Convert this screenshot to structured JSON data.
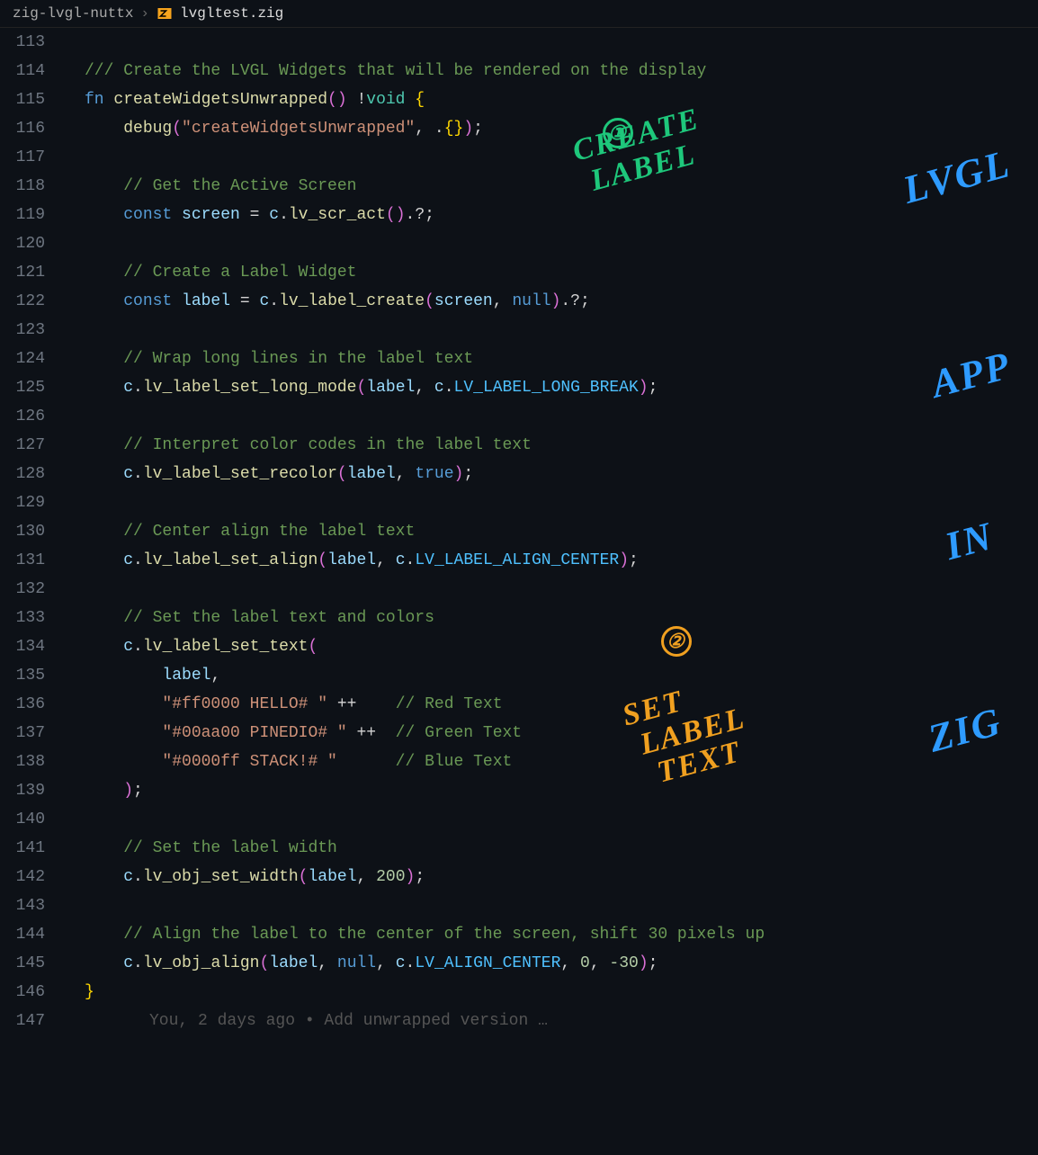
{
  "breadcrumb": {
    "folder": "zig-lvgl-nuttx",
    "file": "lvgltest.zig"
  },
  "annotations": {
    "circle1": "①",
    "create_label": "CREATE LABEL",
    "lvgl": "LVGL",
    "app": "APP",
    "in": "IN",
    "zig": "ZIG",
    "circle2": "②",
    "set_label_text": "SET LABEL TEXT"
  },
  "blame": "You, 2 days ago • Add unwrapped version …",
  "lines": [
    {
      "num": "113",
      "bar": "hash",
      "tokens": []
    },
    {
      "num": "114",
      "bar": "hash",
      "tokens": [
        [
          "comment",
          "/// Create the LVGL Widgets that will be rendered on the display"
        ]
      ]
    },
    {
      "num": "115",
      "tokens": [
        [
          "keyword",
          "fn "
        ],
        [
          "fn",
          "createWidgetsUnwrapped"
        ],
        [
          "paren",
          "()"
        ],
        [
          "punc",
          " !"
        ],
        [
          "type",
          "void"
        ],
        [
          "punc",
          " "
        ],
        [
          "brace",
          "{"
        ]
      ]
    },
    {
      "num": "116",
      "tokens": [
        [
          "punc",
          "    "
        ],
        [
          "fn",
          "debug"
        ],
        [
          "paren",
          "("
        ],
        [
          "string",
          "\"createWidgetsUnwrapped\""
        ],
        [
          "punc",
          ", ."
        ],
        [
          "brace",
          "{}"
        ],
        [
          "paren",
          ")"
        ],
        [
          "punc",
          ";"
        ]
      ]
    },
    {
      "num": "117",
      "tokens": []
    },
    {
      "num": "118",
      "tokens": [
        [
          "punc",
          "    "
        ],
        [
          "comment",
          "// Get the Active Screen"
        ]
      ]
    },
    {
      "num": "119",
      "tokens": [
        [
          "punc",
          "    "
        ],
        [
          "keyword",
          "const "
        ],
        [
          "var",
          "screen"
        ],
        [
          "punc",
          " = "
        ],
        [
          "var",
          "c"
        ],
        [
          "punc",
          "."
        ],
        [
          "fn",
          "lv_scr_act"
        ],
        [
          "paren",
          "()"
        ],
        [
          "punc",
          ".?;"
        ]
      ]
    },
    {
      "num": "120",
      "tokens": []
    },
    {
      "num": "121",
      "tokens": [
        [
          "punc",
          "    "
        ],
        [
          "comment",
          "// Create a Label Widget"
        ]
      ]
    },
    {
      "num": "122",
      "tokens": [
        [
          "punc",
          "    "
        ],
        [
          "keyword",
          "const "
        ],
        [
          "var",
          "label"
        ],
        [
          "punc",
          " = "
        ],
        [
          "var",
          "c"
        ],
        [
          "punc",
          "."
        ],
        [
          "fn",
          "lv_label_create"
        ],
        [
          "paren",
          "("
        ],
        [
          "var",
          "screen"
        ],
        [
          "punc",
          ", "
        ],
        [
          "null",
          "null"
        ],
        [
          "paren",
          ")"
        ],
        [
          "punc",
          ".?;"
        ]
      ]
    },
    {
      "num": "123",
      "tokens": []
    },
    {
      "num": "124",
      "tokens": [
        [
          "punc",
          "    "
        ],
        [
          "comment",
          "// Wrap long lines in the label text"
        ]
      ]
    },
    {
      "num": "125",
      "tokens": [
        [
          "punc",
          "    "
        ],
        [
          "var",
          "c"
        ],
        [
          "punc",
          "."
        ],
        [
          "fn",
          "lv_label_set_long_mode"
        ],
        [
          "paren",
          "("
        ],
        [
          "var",
          "label"
        ],
        [
          "punc",
          ", "
        ],
        [
          "var",
          "c"
        ],
        [
          "punc",
          "."
        ],
        [
          "const",
          "LV_LABEL_LONG_BREAK"
        ],
        [
          "paren",
          ")"
        ],
        [
          "punc",
          ";"
        ]
      ]
    },
    {
      "num": "126",
      "tokens": []
    },
    {
      "num": "127",
      "tokens": [
        [
          "punc",
          "    "
        ],
        [
          "comment",
          "// Interpret color codes in the label text"
        ]
      ]
    },
    {
      "num": "128",
      "tokens": [
        [
          "punc",
          "    "
        ],
        [
          "var",
          "c"
        ],
        [
          "punc",
          "."
        ],
        [
          "fn",
          "lv_label_set_recolor"
        ],
        [
          "paren",
          "("
        ],
        [
          "var",
          "label"
        ],
        [
          "punc",
          ", "
        ],
        [
          "null",
          "true"
        ],
        [
          "paren",
          ")"
        ],
        [
          "punc",
          ";"
        ]
      ]
    },
    {
      "num": "129",
      "tokens": []
    },
    {
      "num": "130",
      "tokens": [
        [
          "punc",
          "    "
        ],
        [
          "comment",
          "// Center align the label text"
        ]
      ]
    },
    {
      "num": "131",
      "tokens": [
        [
          "punc",
          "    "
        ],
        [
          "var",
          "c"
        ],
        [
          "punc",
          "."
        ],
        [
          "fn",
          "lv_label_set_align"
        ],
        [
          "paren",
          "("
        ],
        [
          "var",
          "label"
        ],
        [
          "punc",
          ", "
        ],
        [
          "var",
          "c"
        ],
        [
          "punc",
          "."
        ],
        [
          "const",
          "LV_LABEL_ALIGN_CENTER"
        ],
        [
          "paren",
          ")"
        ],
        [
          "punc",
          ";"
        ]
      ]
    },
    {
      "num": "132",
      "tokens": []
    },
    {
      "num": "133",
      "tokens": [
        [
          "punc",
          "    "
        ],
        [
          "comment",
          "// Set the label text and colors"
        ]
      ]
    },
    {
      "num": "134",
      "tokens": [
        [
          "punc",
          "    "
        ],
        [
          "var",
          "c"
        ],
        [
          "punc",
          "."
        ],
        [
          "fn",
          "lv_label_set_text"
        ],
        [
          "paren",
          "("
        ]
      ]
    },
    {
      "num": "135",
      "tokens": [
        [
          "punc",
          "        "
        ],
        [
          "var",
          "label"
        ],
        [
          "punc",
          ","
        ]
      ]
    },
    {
      "num": "136",
      "tokens": [
        [
          "punc",
          "        "
        ],
        [
          "string",
          "\"#ff0000 HELLO# \""
        ],
        [
          "punc",
          " ++    "
        ],
        [
          "comment",
          "// Red Text"
        ]
      ]
    },
    {
      "num": "137",
      "tokens": [
        [
          "punc",
          "        "
        ],
        [
          "string",
          "\"#00aa00 PINEDIO# \""
        ],
        [
          "punc",
          " ++  "
        ],
        [
          "comment",
          "// Green Text"
        ]
      ]
    },
    {
      "num": "138",
      "tokens": [
        [
          "punc",
          "        "
        ],
        [
          "string",
          "\"#0000ff STACK!# \""
        ],
        [
          "punc",
          "      "
        ],
        [
          "comment",
          "// Blue Text"
        ]
      ]
    },
    {
      "num": "139",
      "tokens": [
        [
          "punc",
          "    "
        ],
        [
          "paren",
          ")"
        ],
        [
          "punc",
          ";"
        ]
      ]
    },
    {
      "num": "140",
      "tokens": []
    },
    {
      "num": "141",
      "tokens": [
        [
          "punc",
          "    "
        ],
        [
          "comment",
          "// Set the label width"
        ]
      ]
    },
    {
      "num": "142",
      "tokens": [
        [
          "punc",
          "    "
        ],
        [
          "var",
          "c"
        ],
        [
          "punc",
          "."
        ],
        [
          "fn",
          "lv_obj_set_width"
        ],
        [
          "paren",
          "("
        ],
        [
          "var",
          "label"
        ],
        [
          "punc",
          ", "
        ],
        [
          "num",
          "200"
        ],
        [
          "paren",
          ")"
        ],
        [
          "punc",
          ";"
        ]
      ]
    },
    {
      "num": "143",
      "tokens": []
    },
    {
      "num": "144",
      "tokens": [
        [
          "punc",
          "    "
        ],
        [
          "comment",
          "// Align the label to the center of the screen, shift 30 pixels up"
        ]
      ]
    },
    {
      "num": "145",
      "tokens": [
        [
          "punc",
          "    "
        ],
        [
          "var",
          "c"
        ],
        [
          "punc",
          "."
        ],
        [
          "fn",
          "lv_obj_align"
        ],
        [
          "paren",
          "("
        ],
        [
          "var",
          "label"
        ],
        [
          "punc",
          ", "
        ],
        [
          "null",
          "null"
        ],
        [
          "punc",
          ", "
        ],
        [
          "var",
          "c"
        ],
        [
          "punc",
          "."
        ],
        [
          "const",
          "LV_ALIGN_CENTER"
        ],
        [
          "punc",
          ", "
        ],
        [
          "num",
          "0"
        ],
        [
          "punc",
          ", "
        ],
        [
          "num",
          "-30"
        ],
        [
          "paren",
          ")"
        ],
        [
          "punc",
          ";"
        ]
      ]
    },
    {
      "num": "146",
      "tokens": [
        [
          "brace",
          "}"
        ]
      ]
    },
    {
      "num": "147",
      "blame": true,
      "tokens": []
    }
  ]
}
